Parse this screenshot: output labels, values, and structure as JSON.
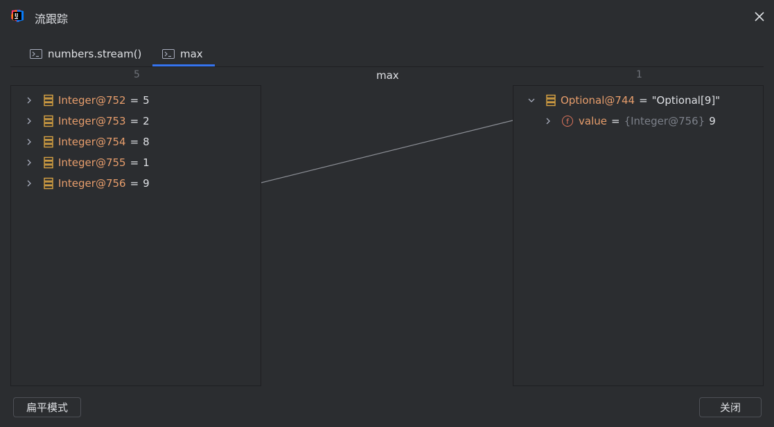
{
  "window": {
    "title": "流跟踪",
    "app_icon": "intellij-idea-icon",
    "close_icon": "close-icon"
  },
  "tabs": [
    {
      "label": "numbers.stream()",
      "icon": "terminal-icon",
      "selected": false
    },
    {
      "label": "max",
      "icon": "terminal-icon",
      "selected": true
    }
  ],
  "columns": {
    "left_count": "5",
    "operation": "max",
    "right_count": "1"
  },
  "left_items": [
    {
      "name": "Integer@752",
      "eq": "=",
      "value": "5"
    },
    {
      "name": "Integer@753",
      "eq": "=",
      "value": "2"
    },
    {
      "name": "Integer@754",
      "eq": "=",
      "value": "8"
    },
    {
      "name": "Integer@755",
      "eq": "=",
      "value": "1"
    },
    {
      "name": "Integer@756",
      "eq": "=",
      "value": "9"
    }
  ],
  "right_items": {
    "root": {
      "name": "Optional@744",
      "eq": "=",
      "value": "\"Optional[9]\"",
      "expanded": true
    },
    "child": {
      "name": "value",
      "eq": "=",
      "ref": "{Integer@756}",
      "value": "9",
      "icon": "field-icon"
    }
  },
  "buttons": {
    "flat_mode": "扁平模式",
    "close": "关闭"
  },
  "colors": {
    "background": "#2b2d30",
    "accent": "#3574f0",
    "name": "#e89e6c",
    "border": "#1e1f22"
  }
}
